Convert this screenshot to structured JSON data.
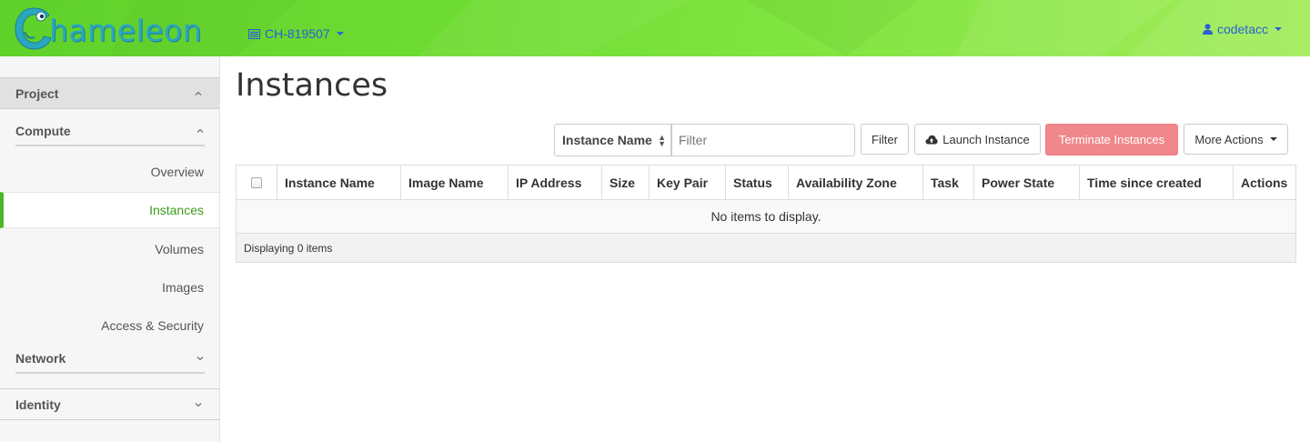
{
  "header": {
    "logo_text": "hameleon",
    "project_selector": "CH-819507",
    "user_menu": "codetacc",
    "icons": [
      "chameleon-logo",
      "project-icon",
      "user-icon",
      "caret-down-icon"
    ]
  },
  "sidebar": {
    "project_label": "Project",
    "compute_label": "Compute",
    "compute_items": [
      "Overview",
      "Instances",
      "Volumes",
      "Images",
      "Access & Security"
    ],
    "active_item": "Instances",
    "network_label": "Network",
    "identity_label": "Identity"
  },
  "main": {
    "title": "Instances",
    "filter": {
      "field_select": "Instance Name",
      "placeholder": "Filter",
      "filter_button": "Filter"
    },
    "actions": {
      "launch": "Launch Instance",
      "terminate": "Terminate Instances",
      "more": "More Actions"
    },
    "table": {
      "columns": [
        "Instance Name",
        "Image Name",
        "IP Address",
        "Size",
        "Key Pair",
        "Status",
        "Availability Zone",
        "Task",
        "Power State",
        "Time since created",
        "Actions"
      ],
      "empty_message": "No items to display.",
      "footer": "Displaying 0 items"
    }
  },
  "colors": {
    "topbar_green": "#6fdc33",
    "link_blue": "#2a5fd6",
    "active_green": "#3c9b1f",
    "terminate_red": "#f0878a"
  }
}
